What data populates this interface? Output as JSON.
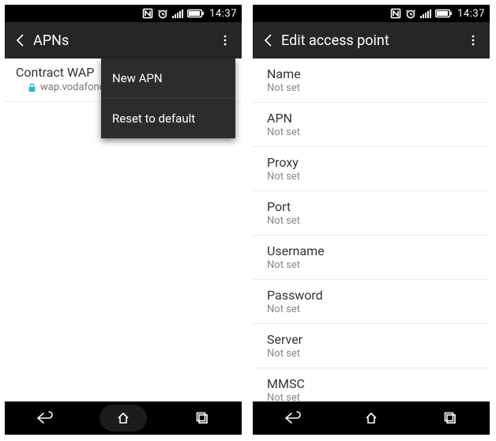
{
  "status": {
    "time": "14:37"
  },
  "left": {
    "title": "APNs",
    "apn": {
      "title": "Contract WAP",
      "sub": "wap.vodafone.c"
    },
    "menu": {
      "new": "New APN",
      "reset": "Reset to default"
    }
  },
  "right": {
    "title": "Edit access point",
    "fields": [
      {
        "label": "Name",
        "value": "Not set"
      },
      {
        "label": "APN",
        "value": "Not set"
      },
      {
        "label": "Proxy",
        "value": "Not set"
      },
      {
        "label": "Port",
        "value": "Not set"
      },
      {
        "label": "Username",
        "value": "Not set"
      },
      {
        "label": "Password",
        "value": "Not set"
      },
      {
        "label": "Server",
        "value": "Not set"
      },
      {
        "label": "MMSC",
        "value": "Not set"
      }
    ]
  }
}
